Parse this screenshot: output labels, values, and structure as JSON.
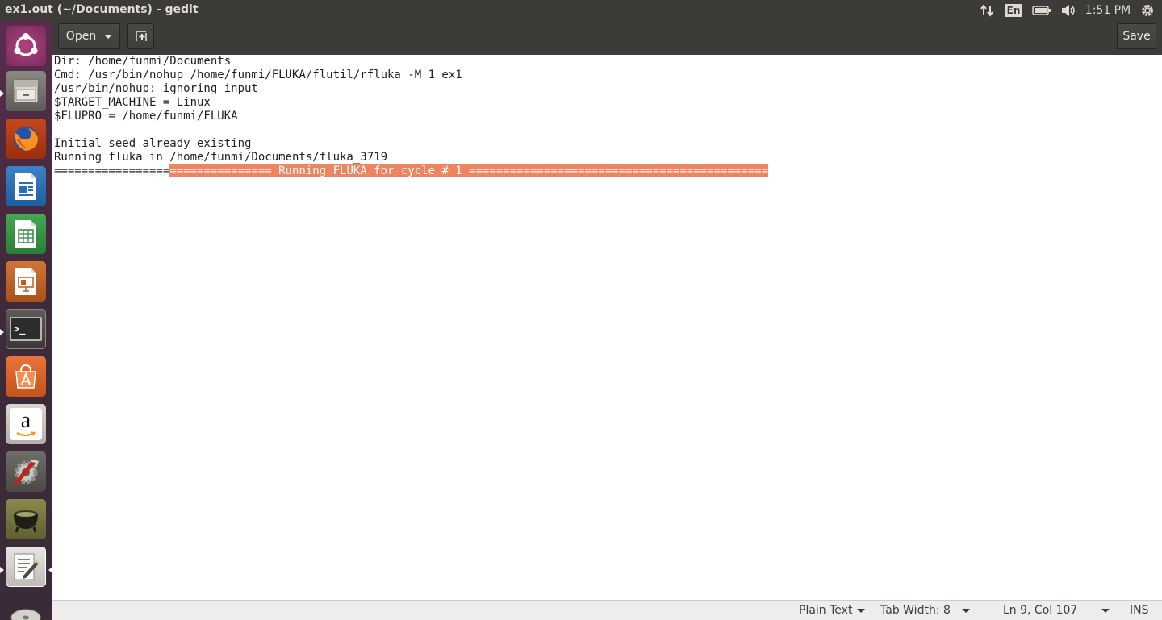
{
  "window": {
    "title": "ex1.out (~/Documents) - gedit"
  },
  "panel": {
    "keyboard_layout": "En",
    "clock": "1:51 PM",
    "icons": [
      "network-arrows-icon",
      "keyboard-layout-icon",
      "battery-icon",
      "volume-icon",
      "settings-gear-icon"
    ]
  },
  "launcher": {
    "items": [
      {
        "name": "ubuntu-dash-icon"
      },
      {
        "name": "files-icon"
      },
      {
        "name": "firefox-icon"
      },
      {
        "name": "libreoffice-writer-icon"
      },
      {
        "name": "libreoffice-calc-icon"
      },
      {
        "name": "libreoffice-impress-icon"
      },
      {
        "name": "terminal-icon"
      },
      {
        "name": "software-center-icon"
      },
      {
        "name": "amazon-icon"
      },
      {
        "name": "system-settings-icon"
      },
      {
        "name": "cauldron-app-icon"
      },
      {
        "name": "text-editor-icon"
      },
      {
        "name": "dvd-icon"
      }
    ],
    "amazon_letter": "a",
    "terminal_prompt": ">_"
  },
  "toolbar": {
    "open_label": "Open",
    "save_label": "Save"
  },
  "document": {
    "lines": [
      "Dir: /home/funmi/Documents",
      "Cmd: /usr/bin/nohup /home/funmi/FLUKA/flutil/rfluka -M 1 ex1",
      "/usr/bin/nohup: ignoring input",
      "$TARGET_MACHINE = Linux",
      "$FLUPRO = /home/funmi/FLUKA",
      "",
      "Initial seed already existing",
      "Running fluka in /home/funmi/Documents/fluka_3719"
    ],
    "last_line_unselected": "=================",
    "last_line_selected": "=============== Running FLUKA for cycle # 1 ============================================"
  },
  "statusbar": {
    "language": "Plain Text",
    "tab_width": "Tab Width: 8",
    "position": "Ln 9, Col 107",
    "mode": "INS"
  },
  "colors": {
    "selection": "#f0845f",
    "panel": "#3c3b37"
  }
}
